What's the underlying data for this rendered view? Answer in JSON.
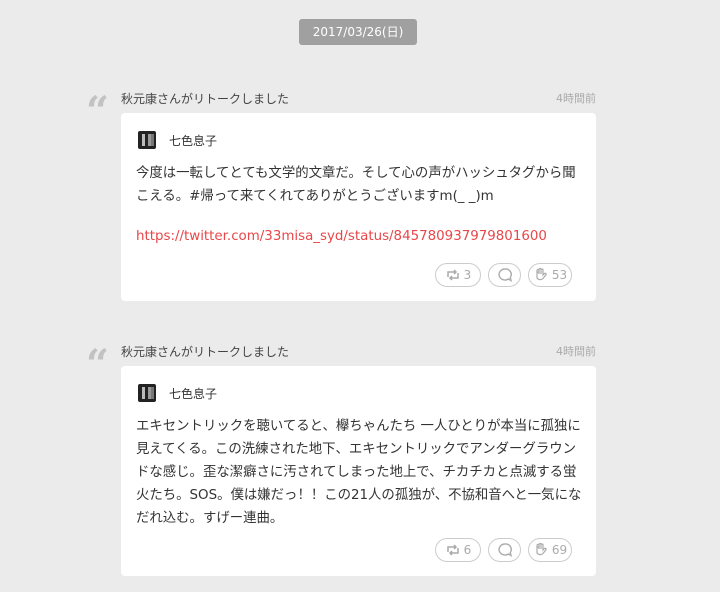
{
  "date_label": "2017/03/26(日)",
  "posts": [
    {
      "retweet_text": "秋元康さんがリトークしました",
      "time": "4時間前",
      "author": "七色息子",
      "text": "今度は一転してとても文学的文章だ。そして心の声がハッシュタグから聞こえる。#帰って来てくれてありがとうございますm(_ _)m",
      "link": "https://twitter.com/33misa_syd/status/845780937979801600",
      "retalk_count": "3",
      "like_count": "53"
    },
    {
      "retweet_text": "秋元康さんがリトークしました",
      "time": "4時間前",
      "author": "七色息子",
      "text": "エキセントリックを聴いてると、欅ちゃんたち 一人ひとりが本当に孤独に見えてくる。この洗練された地下、エキセントリックでアンダーグラウンドな感じ。歪な潔癖さに汚されてしまった地上で、チカチカと点滅する蛍火たち。SOS。僕は嫌だっ！！この21人の孤独が、不協和音へと一気になだれ込む。すげー連曲。",
      "retalk_count": "6",
      "like_count": "69"
    }
  ]
}
